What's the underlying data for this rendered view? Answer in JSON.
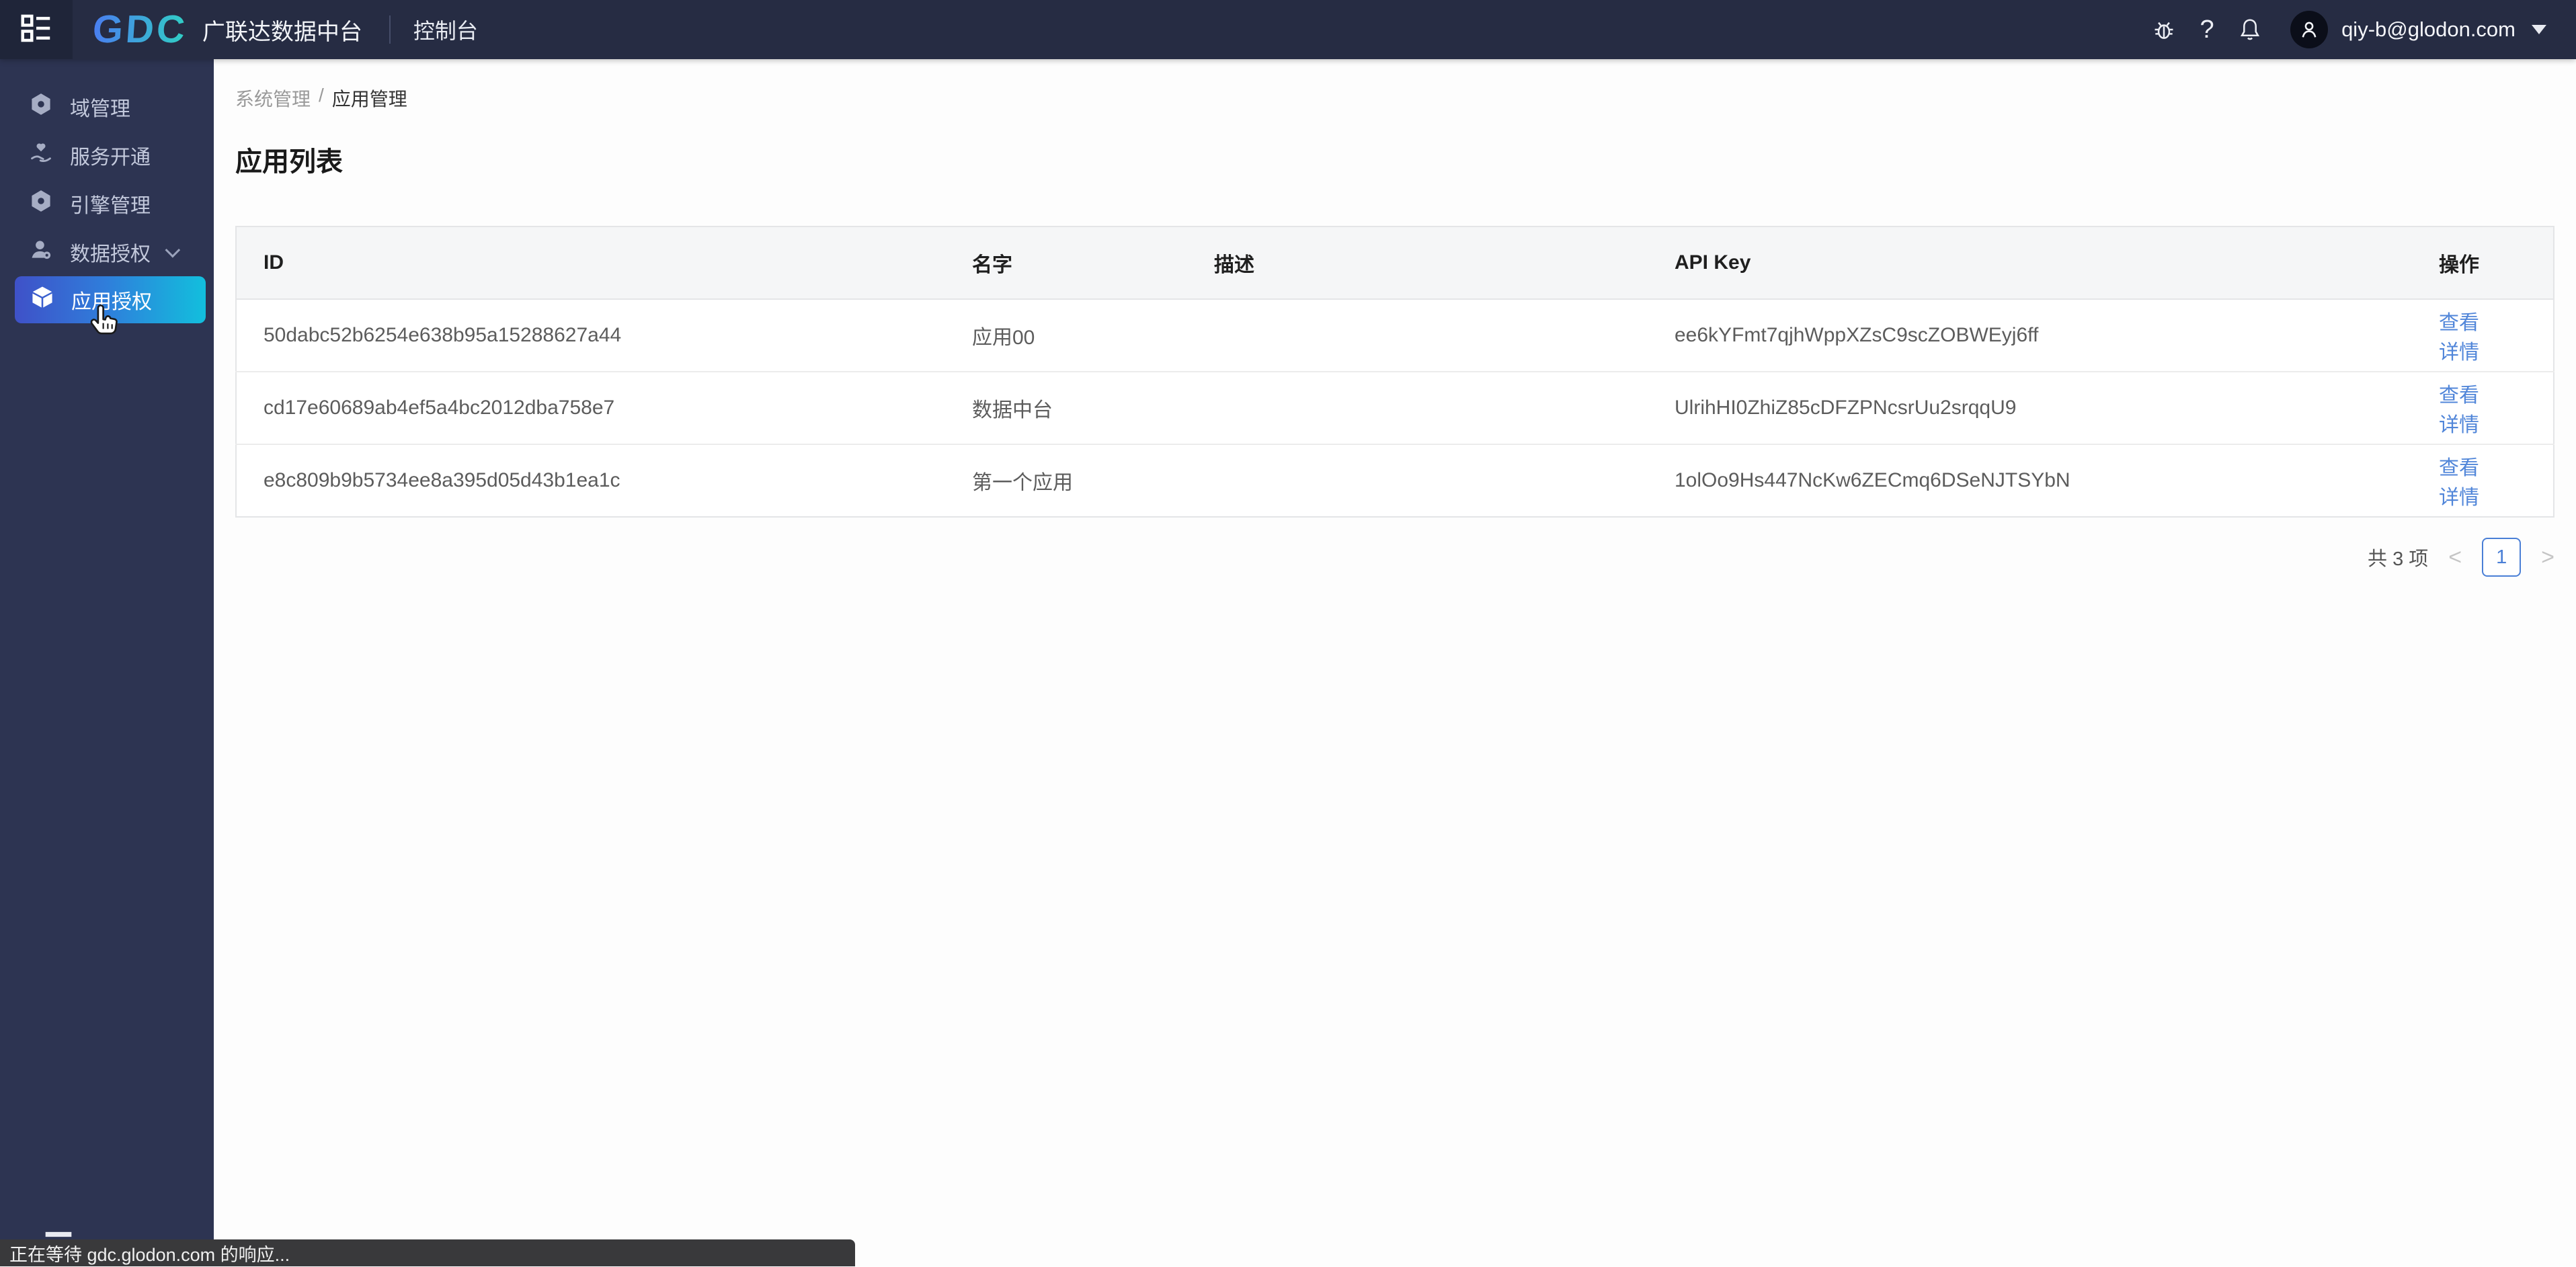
{
  "topbar": {
    "logo_text": "GDC",
    "product_name": "广联达数据中台",
    "console_label": "控制台",
    "user_email": "qiy-b@glodon.com"
  },
  "sidebar": {
    "items": [
      {
        "label": "域管理",
        "icon": "hexagon-nut-icon",
        "active": false
      },
      {
        "label": "服务开通",
        "icon": "hand-heart-icon",
        "active": false
      },
      {
        "label": "引擎管理",
        "icon": "hexagon-nut-icon",
        "active": false
      },
      {
        "label": "数据授权",
        "icon": "user-gear-icon",
        "active": false,
        "has_chevron": true
      },
      {
        "label": "应用授权",
        "icon": "cube-icon",
        "active": true
      }
    ]
  },
  "breadcrumb": {
    "parent": "系统管理",
    "separator": "/",
    "current": "应用管理"
  },
  "page": {
    "title": "应用列表"
  },
  "table": {
    "columns": [
      "ID",
      "名字",
      "描述",
      "API Key",
      "操作"
    ],
    "rows": [
      {
        "id": "50dabc52b6254e638b95a15288627a44",
        "name": "应用00",
        "description": "",
        "api_key": "ee6kYFmt7qjhWppXZsC9scZOBWEyj6ff",
        "action": "查看详情"
      },
      {
        "id": "cd17e60689ab4ef5a4bc2012dba758e7",
        "name": "数据中台",
        "description": "",
        "api_key": "UlrihHI0ZhiZ85cDFZPNcsrUu2srqqU9",
        "action": "查看详情"
      },
      {
        "id": "e8c809b9b5734ee8a395d05d43b1ea1c",
        "name": "第一个应用",
        "description": "",
        "api_key": "1olOo9Hs447NcKw6ZECmq6DSeNJTSYbN",
        "action": "查看详情"
      }
    ]
  },
  "pagination": {
    "total_label": "共 3 项",
    "prev": "<",
    "next": ">",
    "current_page": "1"
  },
  "statusbar": {
    "text": "正在等待 gdc.glodon.com 的响应..."
  },
  "colors": {
    "topbar_bg": "#262c43",
    "rail_bg": "#1f2539",
    "sidebar_bg": "#2d3452",
    "active_gradient_start": "#3f51c8",
    "active_gradient_end": "#12bfdd",
    "logo_gradient_start": "#4a7df0",
    "logo_gradient_end": "#30d0c4",
    "link_blue": "#5186d9",
    "pagination_blue": "#4a7fd6"
  }
}
